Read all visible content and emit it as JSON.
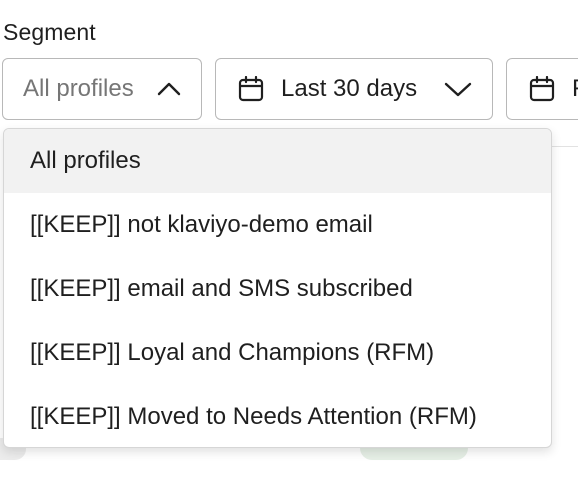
{
  "segment": {
    "label": "Segment",
    "selected_value": "All profiles",
    "expanded": true
  },
  "date_range": {
    "value": "Last 30 days"
  },
  "compare": {
    "value_fragment": "F"
  },
  "dropdown": {
    "options": [
      {
        "label": "All profiles",
        "selected": true
      },
      {
        "label": "[[KEEP]] not klaviyo-demo email",
        "selected": false
      },
      {
        "label": "[[KEEP]] email and SMS subscribed",
        "selected": false
      },
      {
        "label": "[[KEEP]] Loyal and Champions (RFM)",
        "selected": false
      },
      {
        "label": "[[KEEP]] Moved to Needs Attention (RFM)",
        "selected": false
      }
    ]
  },
  "colors": {
    "border": "#b8b8b8",
    "selected_bg": "#f2f2f2",
    "placeholder_text": "#767676",
    "text": "#1f1f1f"
  },
  "icons": [
    "chevron-up-icon",
    "calendar-icon",
    "chevron-down-icon"
  ]
}
